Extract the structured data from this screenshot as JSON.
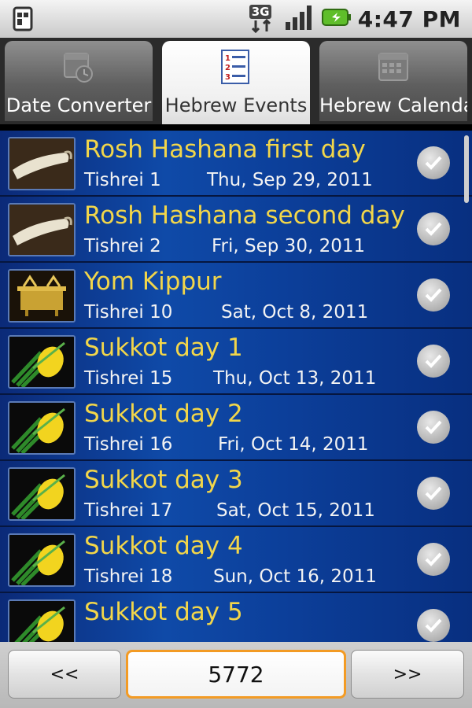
{
  "status": {
    "time": "4:47 PM",
    "network_label": "3G",
    "icons": [
      "sim-icon",
      "3g-icon",
      "signal-icon",
      "battery-icon"
    ]
  },
  "tabs": [
    {
      "label": "Date Converter",
      "icon": "calendar-clock-icon",
      "active": false
    },
    {
      "label": "Hebrew Events",
      "icon": "numbered-list-icon",
      "active": true
    },
    {
      "label": "Hebrew Calendar",
      "icon": "calendar-grid-icon",
      "active": false
    }
  ],
  "events": [
    {
      "title": "Rosh Hashana first day",
      "hebrew_date": "Tishrei 1",
      "date": "Thu, Sep 29, 2011",
      "image": "shofar"
    },
    {
      "title": "Rosh Hashana second day",
      "hebrew_date": "Tishrei 2",
      "date": "Fri, Sep 30, 2011",
      "image": "shofar"
    },
    {
      "title": "Yom Kippur",
      "hebrew_date": "Tishrei 10",
      "date": "Sat, Oct 8, 2011",
      "image": "ark"
    },
    {
      "title": "Sukkot day 1",
      "hebrew_date": "Tishrei 15",
      "date": "Thu, Oct 13, 2011",
      "image": "etrog"
    },
    {
      "title": "Sukkot day 2",
      "hebrew_date": "Tishrei 16",
      "date": "Fri, Oct 14, 2011",
      "image": "etrog"
    },
    {
      "title": "Sukkot day 3",
      "hebrew_date": "Tishrei 17",
      "date": "Sat, Oct 15, 2011",
      "image": "etrog"
    },
    {
      "title": "Sukkot day 4",
      "hebrew_date": "Tishrei 18",
      "date": "Sun, Oct 16, 2011",
      "image": "etrog"
    },
    {
      "title": "Sukkot day 5",
      "hebrew_date": "",
      "date": "",
      "image": "etrog"
    }
  ],
  "footer": {
    "prev_label": "<<",
    "year": "5772",
    "next_label": ">>"
  },
  "colors": {
    "title_yellow": "#f2d64a",
    "row_blue": "#0f4aa8",
    "year_border": "#f39b24"
  }
}
